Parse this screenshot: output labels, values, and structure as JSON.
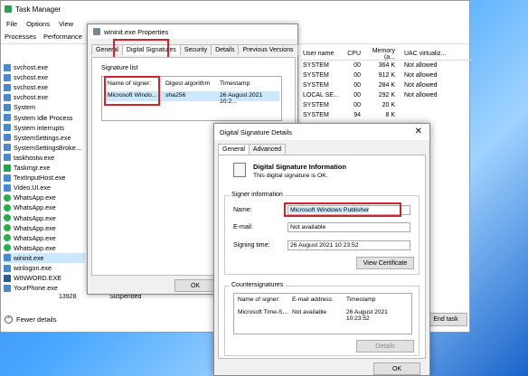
{
  "taskmgr": {
    "title": "Task Manager",
    "menu": [
      "File",
      "Options",
      "View"
    ],
    "tabs": [
      "Processes",
      "Performance"
    ],
    "processes": [
      {
        "name": "svchost.exe",
        "icon": "blue"
      },
      {
        "name": "svchost.exe",
        "icon": "blue"
      },
      {
        "name": "svchost.exe",
        "icon": "blue"
      },
      {
        "name": "svchost.exe",
        "icon": "blue"
      },
      {
        "name": "System",
        "icon": "blue"
      },
      {
        "name": "System Idle Process",
        "icon": "blue"
      },
      {
        "name": "System interrupts",
        "icon": "blue"
      },
      {
        "name": "SystemSettings.exe",
        "icon": "blue"
      },
      {
        "name": "SystemSettingsBroke...",
        "icon": "blue"
      },
      {
        "name": "taskhostw.exe",
        "icon": "blue"
      },
      {
        "name": "Taskmgr.exe",
        "icon": "taskmgr"
      },
      {
        "name": "TextInputHost.exe",
        "icon": "blue"
      },
      {
        "name": "Video.UI.exe",
        "icon": "blue"
      },
      {
        "name": "WhatsApp.exe",
        "icon": "green"
      },
      {
        "name": "WhatsApp.exe",
        "icon": "green"
      },
      {
        "name": "WhatsApp.exe",
        "icon": "green"
      },
      {
        "name": "WhatsApp.exe",
        "icon": "green"
      },
      {
        "name": "WhatsApp.exe",
        "icon": "green"
      },
      {
        "name": "WhatsApp.exe",
        "icon": "green"
      },
      {
        "name": "wininit.exe",
        "icon": "blue"
      },
      {
        "name": "winlogon.exe",
        "icon": "blue"
      },
      {
        "name": "WINWORD.EXE",
        "icon": "word"
      },
      {
        "name": "YourPhone.exe",
        "icon": "blue"
      }
    ],
    "last_row_pid": "13928",
    "last_row_status": "Suspended",
    "right_headers": [
      "User name",
      "CPU",
      "Memory (a...",
      "UAC virtualiz..."
    ],
    "right_rows": [
      [
        "SYSTEM",
        "00",
        "364 K",
        "Not allowed"
      ],
      [
        "SYSTEM",
        "00",
        "912 K",
        "Not allowed"
      ],
      [
        "SYSTEM",
        "00",
        "284 K",
        "Not allowed"
      ],
      [
        "LOCAL SE...",
        "00",
        "292 K",
        "Not allowed"
      ],
      [
        "SYSTEM",
        "00",
        "20 K",
        ""
      ],
      [
        "SYSTEM",
        "94",
        "8 K",
        ""
      ]
    ],
    "fewer_details": "Fewer details",
    "end_task": "End task"
  },
  "props": {
    "title": "wininit.exe Properties",
    "tabs": [
      "General",
      "Digital Signatures",
      "Security",
      "Details",
      "Previous Versions"
    ],
    "signature_list_label": "Signature list",
    "headers": [
      "Name of signer:",
      "Digest algorithm",
      "Timestamp"
    ],
    "row": [
      "Microsoft Windo...",
      "sha256",
      "26 August 2021 10:2..."
    ],
    "ok": "OK"
  },
  "details": {
    "title": "Digital Signature Details",
    "tabs": [
      "General",
      "Advanced"
    ],
    "info_title": "Digital Signature Information",
    "info_sub": "This digital signature is OK.",
    "signer_group": "Signer information",
    "name_label": "Name:",
    "name_value": "Microsoft Windows Publisher",
    "email_label": "E-mail:",
    "email_value": "Not available",
    "time_label": "Signing time:",
    "time_value": "26 August 2021 10:23:52",
    "view_cert": "View Certificate",
    "counter_group": "Countersignatures",
    "counter_headers": [
      "Name of signer:",
      "E-mail address:",
      "Timestamp"
    ],
    "counter_row": [
      "Microsoft Time-S...",
      "Not available",
      "26 August 2021 10:23:52"
    ],
    "details_btn": "Details",
    "ok": "OK",
    "close_glyph": "✕"
  }
}
